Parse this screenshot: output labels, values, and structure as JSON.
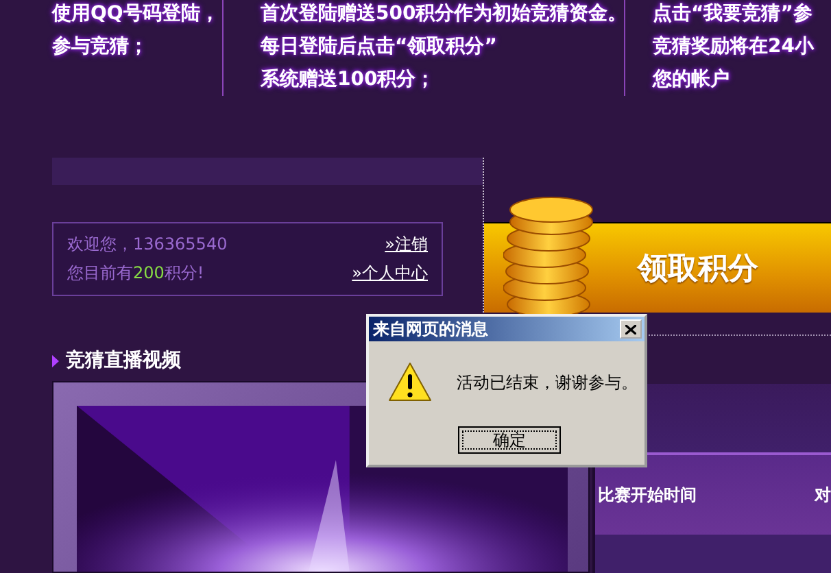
{
  "intro_columns": [
    {
      "lines": [
        "使用QQ号码登陆，",
        "参与竞猜；"
      ]
    },
    {
      "lines": [
        "首次登陆赠送500积分作为初始竞猜资金。",
        "每日登陆后点击“领取积分”",
        "系统赠送100积分；"
      ]
    },
    {
      "lines": [
        "点击“我要竞猜”参",
        "竞猜奖励将在24小",
        "您的帐户"
      ]
    }
  ],
  "account": {
    "welcome": "欢迎您，136365540",
    "points_prefix": "您目前有",
    "points": "200",
    "points_suffix": "积分!",
    "links": [
      "»注销",
      "»个人中心"
    ]
  },
  "claim_banner": {
    "label": "领取积分"
  },
  "video_section": {
    "title": "竞猜直播视频"
  },
  "match_table": {
    "columns": [
      "比赛开始时间",
      "对"
    ]
  },
  "dialog": {
    "title": "来自网页的消息",
    "message": "活动已结束，谢谢参与。",
    "buttons": [
      "确定"
    ]
  }
}
